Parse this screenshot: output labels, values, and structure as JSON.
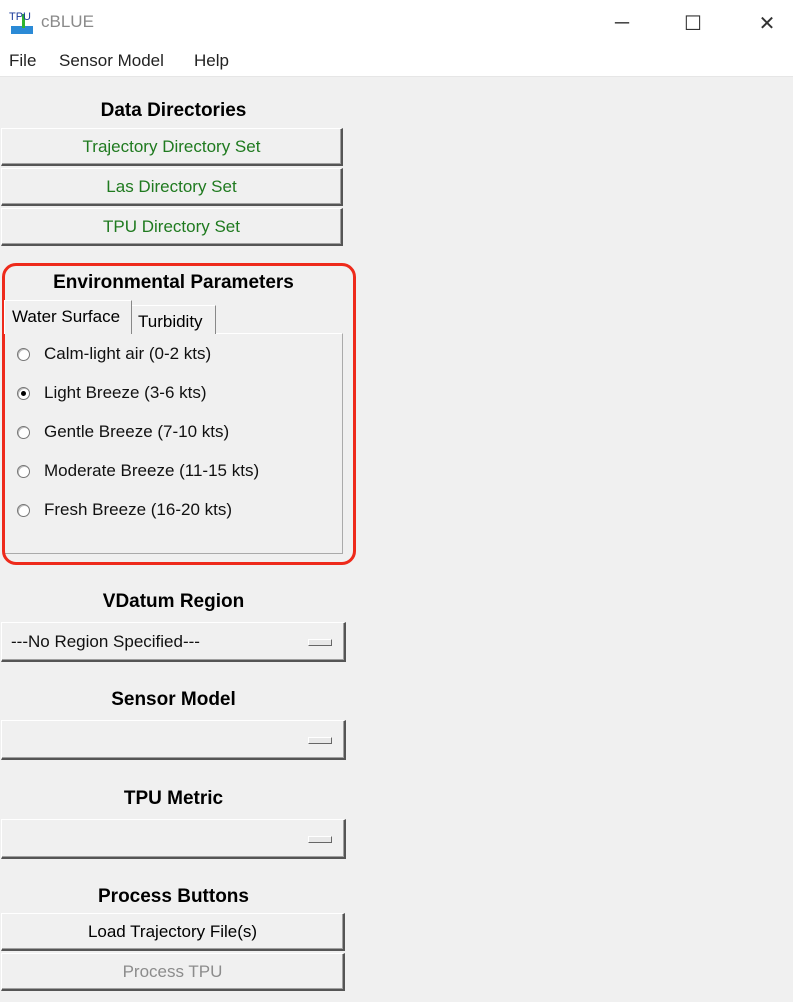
{
  "window": {
    "icon_text": "TPU",
    "title": "cBLUE",
    "minimize_glyph": "─",
    "maximize_glyph": "☐",
    "close_glyph": "✕"
  },
  "menu": [
    "File",
    "Sensor Model",
    "Help"
  ],
  "data_directories": {
    "title": "Data Directories",
    "buttons": [
      "Trajectory Directory Set",
      "Las Directory Set",
      "TPU Directory Set"
    ],
    "button_text_color": "#1f7a1f"
  },
  "environmental_parameters": {
    "title": "Environmental Parameters",
    "highlight_color": "#ee2a1b",
    "tabs": [
      {
        "label": "Water Surface",
        "active": true
      },
      {
        "label": "Turbidity",
        "active": false
      }
    ],
    "options": [
      {
        "label": "Calm-light air (0-2 kts)",
        "selected": false
      },
      {
        "label": "Light Breeze (3-6 kts)",
        "selected": true
      },
      {
        "label": "Gentle Breeze (7-10 kts)",
        "selected": false
      },
      {
        "label": "Moderate Breeze (11-15 kts)",
        "selected": false
      },
      {
        "label": "Fresh Breeze (16-20 kts)",
        "selected": false
      }
    ]
  },
  "vdatum_region": {
    "title": "VDatum Region",
    "value": "---No Region Specified---"
  },
  "sensor_model": {
    "title": "Sensor Model",
    "value": ""
  },
  "tpu_metric": {
    "title": "TPU Metric",
    "value": ""
  },
  "process_buttons": {
    "title": "Process Buttons",
    "load_label": "Load Trajectory File(s)",
    "process_label": "Process TPU",
    "process_enabled": false
  }
}
